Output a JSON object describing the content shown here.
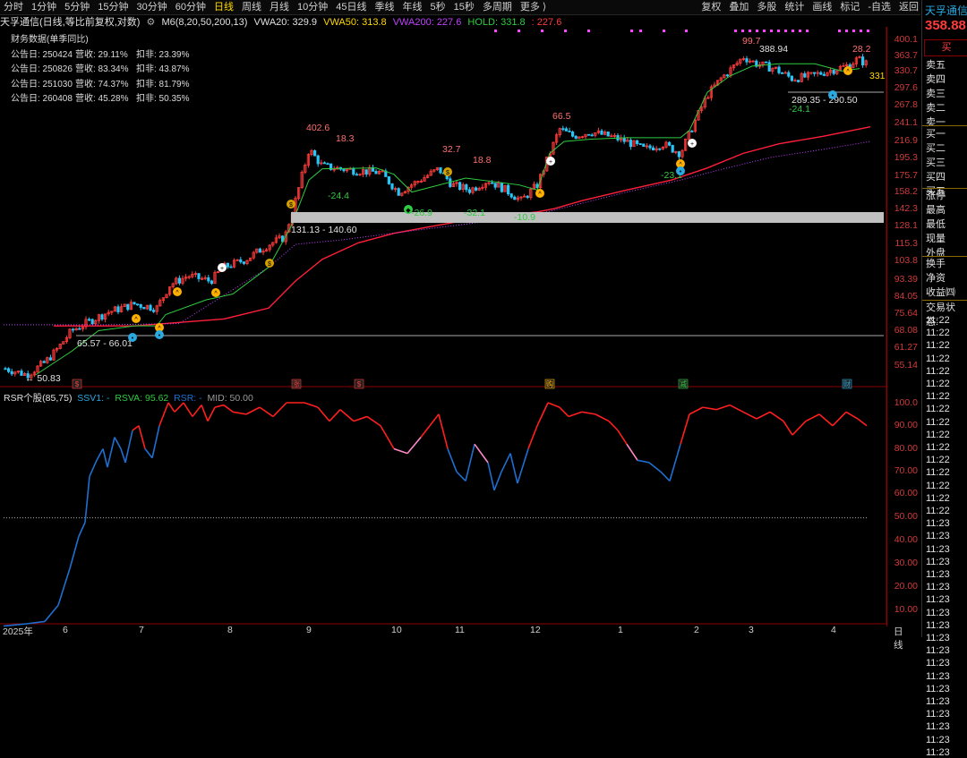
{
  "toolbar": {
    "tabs": [
      "分时",
      "1分钟",
      "5分钟",
      "15分钟",
      "30分钟",
      "60分钟",
      "日线",
      "周线",
      "月线",
      "10分钟",
      "45日线",
      "季线",
      "年线",
      "5秒",
      "15秒",
      "多周期",
      "更多 ⟩"
    ],
    "active_tab": "日线",
    "right": [
      "复权",
      "叠加",
      "多股",
      "统计",
      "画线",
      "标记",
      "-自选",
      "返回"
    ]
  },
  "header": {
    "title": "天孚通信(日线,等比前复权,对数)",
    "ma_label": "M6(8,20,50,200,13)",
    "vwa20": "VWA20: 329.9",
    "vwa50": "VWA50: 313.8",
    "vwa200": "VWA200: 227.6",
    "hold": "HOLD: 331.8",
    "hold2": ": 227.6"
  },
  "financial": {
    "title": "财务数据(单季同比)",
    "rows": [
      {
        "date": "公告日: 250424",
        "rev": "营收:  29.11%",
        "np": "扣非:  23.39%"
      },
      {
        "date": "公告日: 250826",
        "rev": "营收:  83.34%",
        "np": "扣非:  43.87%"
      },
      {
        "date": "公告日: 251030",
        "rev": "营收:  74.37%",
        "np": "扣非:  81.79%"
      },
      {
        "date": "公告日: 260408",
        "rev": "营收:  45.28%",
        "np": "扣非:  50.35%"
      }
    ]
  },
  "price_axis": [
    "400.1",
    "363.7",
    "330.7",
    "297.6",
    "267.8",
    "241.1",
    "216.9",
    "195.3",
    "175.7",
    "158.2",
    "142.3",
    "128.1",
    "115.3",
    "103.8",
    "93.39",
    "84.05",
    "75.64",
    "68.08",
    "61.27",
    "55.14"
  ],
  "rsr_axis": [
    "100.0",
    "90.00",
    "80.00",
    "70.00",
    "60.00",
    "50.00",
    "40.00",
    "30.00",
    "20.00",
    "10.00"
  ],
  "annotations": {
    "p1": "402.6",
    "p2": "18.3",
    "p3": "32.7",
    "p4": "18.8",
    "p5": "66.5",
    "p6": "99.7",
    "p7": "388.94",
    "p8": "28.2",
    "p9": "331",
    "n1": "-24.4",
    "n2": "-26.9",
    "n3": "-32.1",
    "n4": "-10.9",
    "n5": "-23.1",
    "n6": "-24.1",
    "r1": "131.13 - 140.60",
    "r2": "65.57 - 66.01",
    "r3": "289.35 - 290.50",
    "low": "← 50.83"
  },
  "event_markers": [
    "涨",
    "$",
    "$",
    "$",
    "购",
    "减",
    "财"
  ],
  "sub_indicator": {
    "name": "RSR个股(85,75)",
    "ssv1": "SSV1: -",
    "rsva": "RSVA: 95.62",
    "rsr": "RSR: -",
    "mid": "MID: 50.00"
  },
  "x_axis": [
    "2025年",
    "6",
    "7",
    "8",
    "9",
    "10",
    "11",
    "12",
    "1",
    "2",
    "3",
    "4",
    "日线"
  ],
  "side": {
    "name": "天孚通信",
    "price": "358.88",
    "buy": "买",
    "sell": [
      "卖五",
      "卖四",
      "卖三",
      "卖二",
      "卖一"
    ],
    "buyq": [
      "买一",
      "买二",
      "买三",
      "买四",
      "买五"
    ],
    "stats": [
      "涨停",
      "最高",
      "最低",
      "现量",
      "外盘"
    ],
    "stats2": [
      "换手",
      "净资",
      "收益㈣"
    ],
    "status": "交易状态:",
    "times": [
      "11:22",
      "11:22",
      "11:22",
      "11:22",
      "11:22",
      "11:22",
      "11:22",
      "11:22",
      "11:22",
      "11:22",
      "11:22",
      "11:22",
      "11:22",
      "11:22",
      "11:22",
      "11:22",
      "11:23",
      "11:23",
      "11:23",
      "11:23",
      "11:23",
      "11:23",
      "11:23",
      "11:23",
      "11:23",
      "11:23",
      "11:23",
      "11:23",
      "11:23",
      "11:23",
      "11:23",
      "11:23",
      "11:23",
      "11:23",
      "11:23"
    ]
  },
  "colors": {
    "up": "#ff3b3b",
    "down": "#29c5f6",
    "green": "#2ecc40",
    "vwa50": "#ffd700",
    "vwa200": "#c040ff",
    "rsr_blue": "#1f6fd0",
    "rsr_pink": "#ff88c8",
    "rsr_red": "#ff1f1f"
  }
}
